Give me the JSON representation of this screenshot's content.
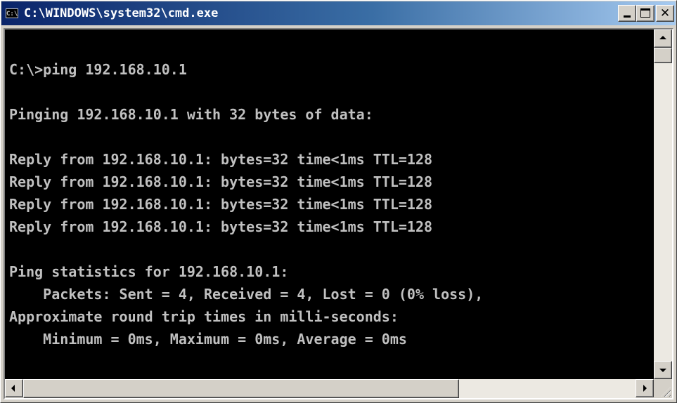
{
  "window": {
    "title": "C:\\WINDOWS\\system32\\cmd.exe",
    "icon_label": "C:\\",
    "controls": {
      "minimize": "minimize-icon",
      "maximize": "maximize-icon",
      "close": "close-icon"
    }
  },
  "console": {
    "text_color": "#c0c0c0",
    "background": "#000000",
    "lines": [
      "",
      "C:\\>ping 192.168.10.1",
      "",
      "Pinging 192.168.10.1 with 32 bytes of data:",
      "",
      "Reply from 192.168.10.1: bytes=32 time<1ms TTL=128",
      "Reply from 192.168.10.1: bytes=32 time<1ms TTL=128",
      "Reply from 192.168.10.1: bytes=32 time<1ms TTL=128",
      "Reply from 192.168.10.1: bytes=32 time<1ms TTL=128",
      "",
      "Ping statistics for 192.168.10.1:",
      "    Packets: Sent = 4, Received = 4, Lost = 0 (0% loss),",
      "Approximate round trip times in milli-seconds:",
      "    Minimum = 0ms, Maximum = 0ms, Average = 0ms",
      ""
    ]
  },
  "scrollbars": {
    "vertical": {
      "up_icon": "up-arrow-icon",
      "down_icon": "down-arrow-icon",
      "position_fraction": 0
    },
    "horizontal": {
      "left_icon": "left-arrow-icon",
      "right_icon": "right-arrow-icon",
      "position_fraction": 0
    }
  },
  "colors": {
    "title_start": "#0a246a",
    "title_end": "#a6caf0",
    "chrome": "#d4d0c8"
  }
}
